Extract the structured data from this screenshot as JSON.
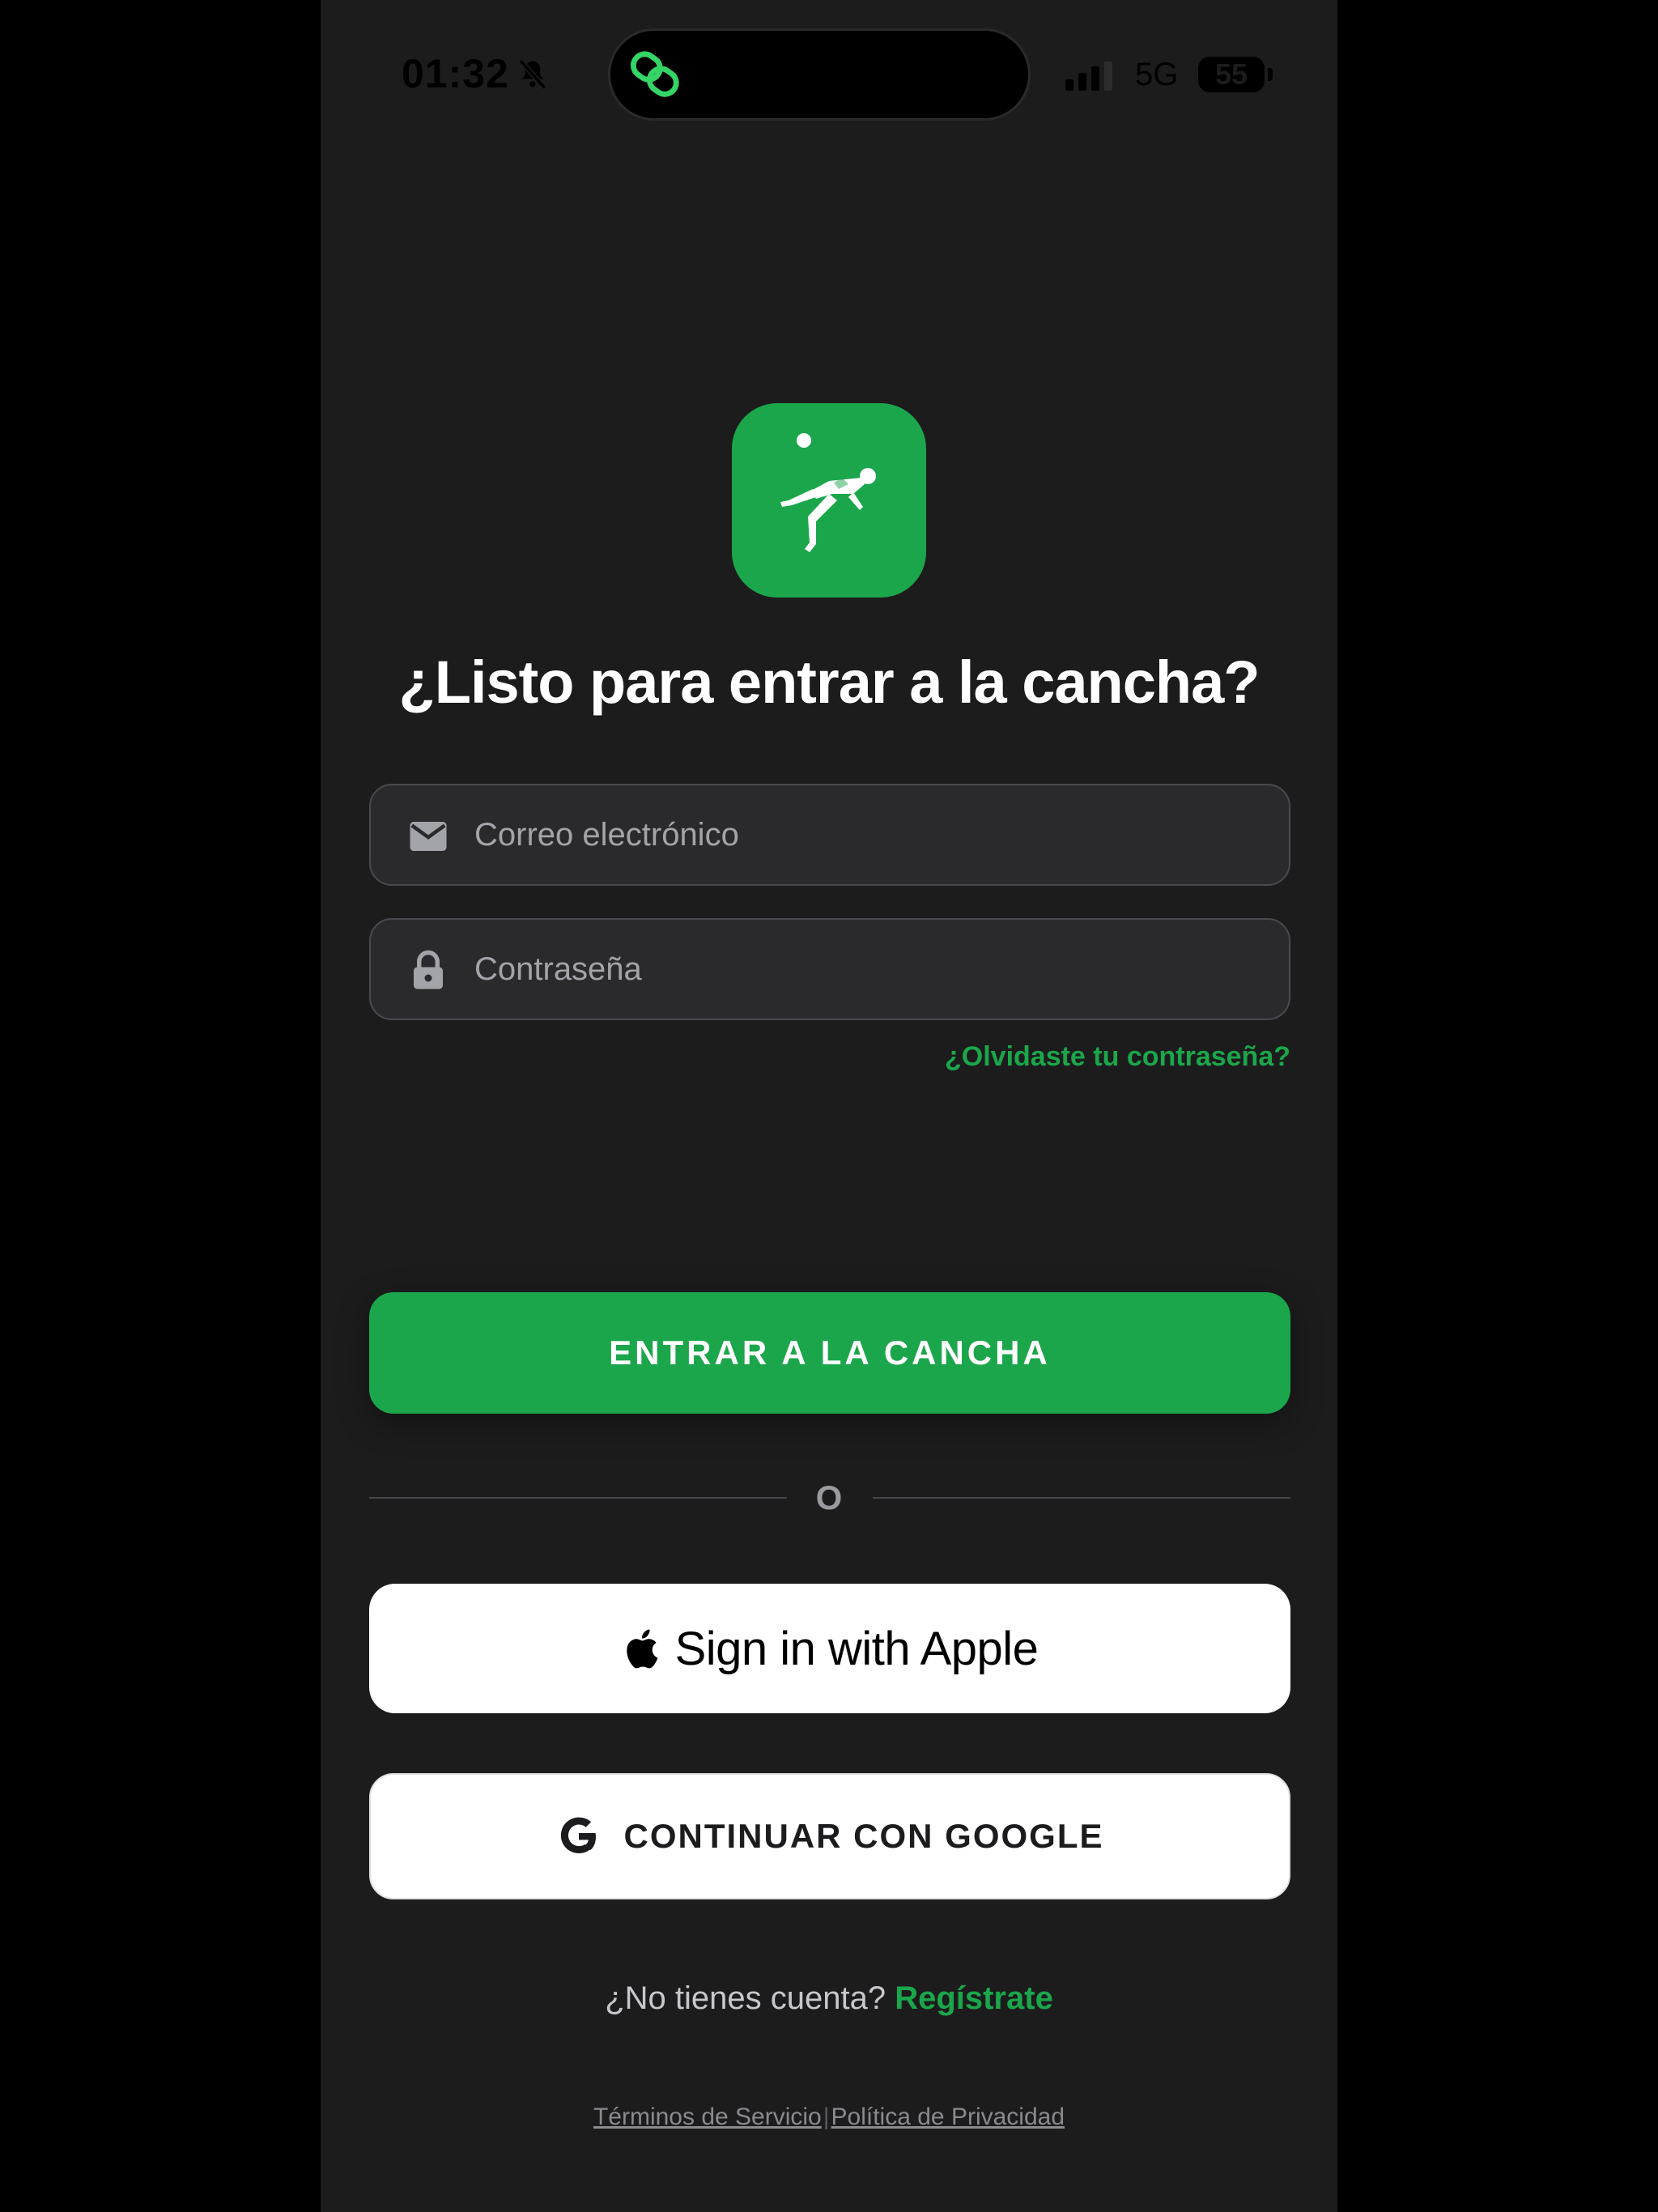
{
  "status_bar": {
    "time": "01:32",
    "network": "5G",
    "battery": "55"
  },
  "icons": {
    "bell": "bell-slash-icon",
    "link": "link-icon",
    "signal": "signal-bars-icon",
    "email": "envelope-icon",
    "password": "lock-icon",
    "apple": "apple-icon",
    "google": "google-g-icon",
    "logo": "bicycle-kick-player-icon"
  },
  "colors": {
    "brand_green": "#1ba64b",
    "background": "#1c1c1d",
    "field_bg": "#2a2a2d"
  },
  "login": {
    "headline": "¿Listo para entrar a la cancha?",
    "email_placeholder": "Correo electrónico",
    "email_value": "",
    "password_placeholder": "Contraseña",
    "password_value": "",
    "forgot_password": "¿Olvidaste tu contraseña?",
    "submit_label": "ENTRAR A LA CANCHA",
    "divider": "O",
    "apple_label": "Sign in with Apple",
    "google_label": "CONTINUAR CON GOOGLE",
    "no_account": "¿No tienes cuenta?",
    "register": "Regístrate"
  },
  "footer": {
    "terms": "Términos de Servicio",
    "separator": "|",
    "privacy": "Política de Privacidad"
  }
}
